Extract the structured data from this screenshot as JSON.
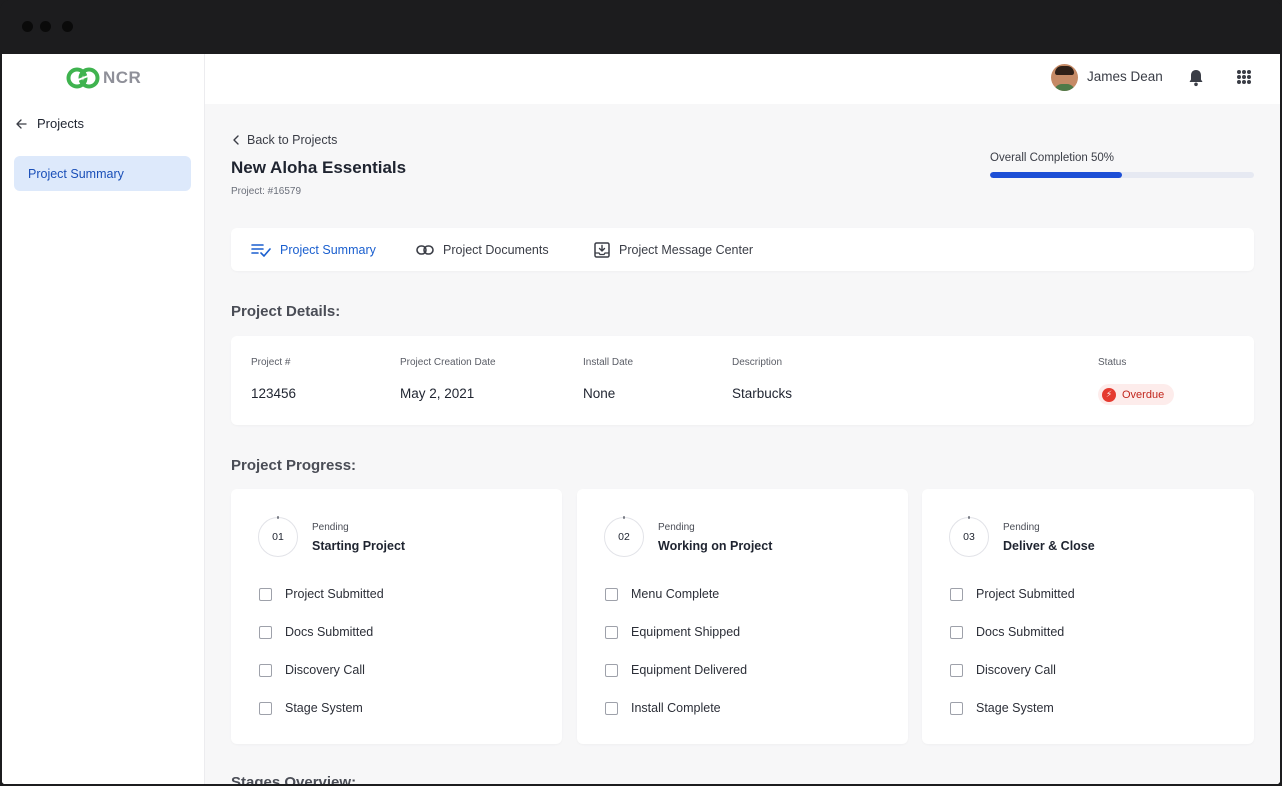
{
  "app": {
    "logo_text": "NCR",
    "brand_color": "#3fb34f"
  },
  "sidebar": {
    "back_label": "Projects",
    "items": [
      {
        "label": "Project Summary",
        "active": true
      }
    ]
  },
  "header": {
    "user_name": "James Dean"
  },
  "main": {
    "back_label": "Back to Projects",
    "title": "New Aloha Essentials",
    "project_number": "Project: #16579",
    "completion": {
      "label": "Overall Completion 50%",
      "value": 0.5,
      "color": "#1d4fd6"
    },
    "tabs": [
      {
        "label": "Project Summary",
        "icon": "checklist-icon",
        "active": true
      },
      {
        "label": "Project Documents",
        "icon": "link-icon",
        "active": false
      },
      {
        "label": "Project Message Center",
        "icon": "inbox-download-icon",
        "active": false
      }
    ],
    "details_heading": "Project Details:",
    "details": {
      "columns": [
        {
          "label": "Project #",
          "value": "123456"
        },
        {
          "label": "Project Creation Date",
          "value": "May 2, 2021"
        },
        {
          "label": "Install Date",
          "value": "None"
        },
        {
          "label": "Description",
          "value": "Starbucks"
        }
      ],
      "status_label": "Status",
      "status_value": "Overdue",
      "status_color": "#e53a2f"
    },
    "progress_heading": "Project Progress:",
    "stages": [
      {
        "number": "01",
        "status": "Pending",
        "name": "Starting Project",
        "tasks": [
          "Project Submitted",
          "Docs Submitted",
          "Discovery Call",
          "Stage System"
        ]
      },
      {
        "number": "02",
        "status": "Pending",
        "name": "Working on Project",
        "tasks": [
          "Menu Complete",
          "Equipment Shipped",
          "Equipment Delivered",
          "Install Complete"
        ]
      },
      {
        "number": "03",
        "status": "Pending",
        "name": "Deliver & Close",
        "tasks": [
          "Project Submitted",
          "Docs Submitted",
          "Discovery Call",
          "Stage System"
        ]
      }
    ],
    "overview_heading": "Stages Overview:"
  }
}
